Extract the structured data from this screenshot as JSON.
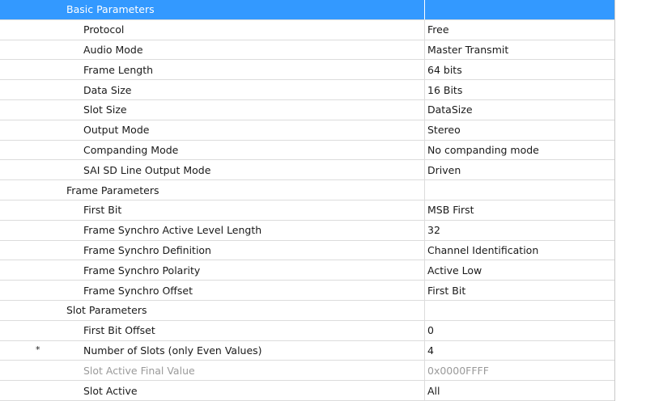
{
  "groups": [
    {
      "title": "Basic Parameters",
      "selected": true,
      "items": [
        {
          "name": "Protocol",
          "value": "Free"
        },
        {
          "name": "Audio Mode",
          "value": "Master Transmit"
        },
        {
          "name": "Frame Length",
          "value": "64 bits"
        },
        {
          "name": "Data Size",
          "value": "16 Bits"
        },
        {
          "name": "Slot Size",
          "value": "DataSize"
        },
        {
          "name": "Output Mode",
          "value": "Stereo"
        },
        {
          "name": "Companding Mode",
          "value": "No companding mode"
        },
        {
          "name": "SAI SD Line Output Mode",
          "value": "Driven"
        }
      ]
    },
    {
      "title": "Frame Parameters",
      "items": [
        {
          "name": "First Bit",
          "value": "MSB First"
        },
        {
          "name": "Frame Synchro Active Level Length",
          "value": "32"
        },
        {
          "name": "Frame Synchro Definition",
          "value": "Channel Identification"
        },
        {
          "name": "Frame Synchro Polarity",
          "value": "Active Low"
        },
        {
          "name": "Frame Synchro Offset",
          "value": "First Bit"
        }
      ]
    },
    {
      "title": "Slot Parameters",
      "items": [
        {
          "name": "First Bit Offset",
          "value": "0"
        },
        {
          "name": "Number of Slots (only Even Values)",
          "value": "4",
          "marker": "*"
        },
        {
          "name": "Slot Active Final Value",
          "value": "0x0000FFFF",
          "disabled": true
        },
        {
          "name": "Slot Active",
          "value": "All"
        }
      ]
    }
  ]
}
